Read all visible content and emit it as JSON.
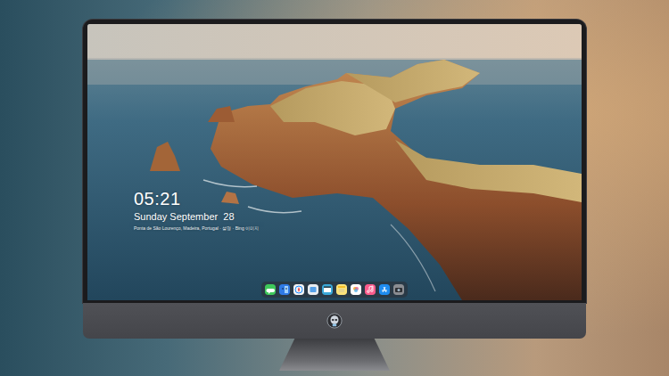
{
  "screen": {
    "time": "05:21",
    "date": "Sunday September  28",
    "caption": "Ponta de São Lourenço, Madeira, Portugal · 설명 · Bing 이미지"
  }
}
